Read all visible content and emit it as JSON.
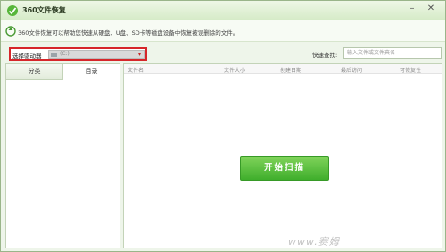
{
  "window": {
    "title": "360文件恢复",
    "minimize": "–",
    "close": "✕"
  },
  "info": {
    "text": "360文件恢复可以帮助您快速从硬盘、U盘、SD卡等磁盘设备中恢复被误删除的文件。"
  },
  "drive": {
    "label": "选择驱动器",
    "value": "(C:)"
  },
  "search": {
    "label": "快速查找:",
    "placeholder": "输入文件或文件夹名"
  },
  "tabs": [
    {
      "label": "分类"
    },
    {
      "label": "目录"
    }
  ],
  "columns": [
    "文件名",
    "文件大小",
    "创建日期",
    "最后访问",
    "可恢复性"
  ],
  "scan_button": {
    "label": "开始扫描"
  },
  "watermark": {
    "text": "www.赛姆"
  }
}
